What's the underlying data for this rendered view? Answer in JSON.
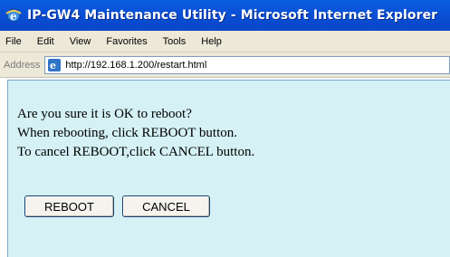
{
  "window": {
    "title": "IP-GW4 Maintenance Utility - Microsoft Internet Explorer"
  },
  "menu": {
    "items": [
      "File",
      "Edit",
      "View",
      "Favorites",
      "Tools",
      "Help"
    ]
  },
  "address": {
    "label": "Address",
    "url": "http://192.168.1.200/restart.html"
  },
  "content": {
    "line1": "Are you sure it is OK to reboot?",
    "line2": "When rebooting, click REBOOT button.",
    "line3": "To cancel REBOOT,click CANCEL button."
  },
  "buttons": {
    "reboot": "REBOOT",
    "cancel": "CANCEL"
  },
  "icons": {
    "app": "ie-icon",
    "page": "page-icon"
  }
}
